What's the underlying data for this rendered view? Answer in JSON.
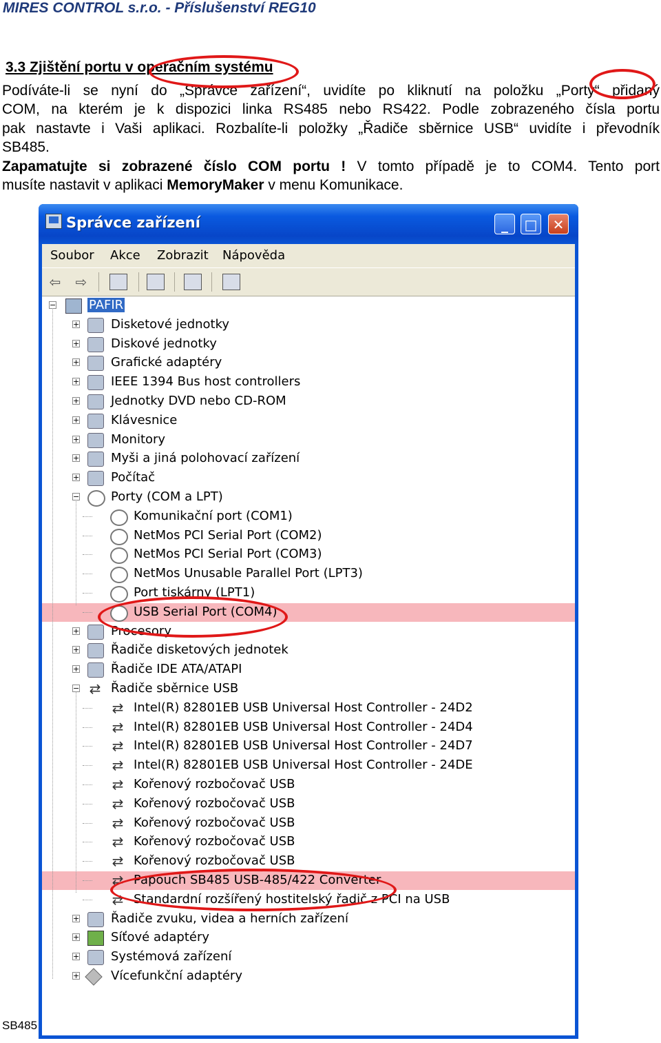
{
  "header": "MIRES CONTROL s.r.o. - Příslušenství REG10",
  "section_title": "3.3 Zjištění portu v operačním systému",
  "para1_lines": [
    "Podíváte-li se nyní do „Správce zařízení“, uvidíte po kliknutí na položku „Porty“ přidaný",
    "COM, na kterém je k dispozici linka RS485 nebo RS422. Podle zobrazeného čísla portu",
    "pak nastavte i Vaši aplikaci. Rozbalíte-li položky „Řadiče sběrnice USB“ uvidíte i převodník",
    "SB485."
  ],
  "para2": {
    "bold1": "Zapamatujte si zobrazené číslo COM portu !",
    "text1": " V tomto případě je to COM4. Tento port",
    "text2": "musíte nastavit v aplikaci ",
    "bold2": "MemoryMaker",
    "text3": " v menu Komunikace."
  },
  "footer": "SB485",
  "window": {
    "title": "Správce zařízení",
    "menu": [
      "Soubor",
      "Akce",
      "Zobrazit",
      "Nápověda"
    ],
    "tree": [
      {
        "label": "PAFIR",
        "level": 0,
        "expander": "minus",
        "icon": "comp",
        "selected": true
      },
      {
        "label": "Disketové jednotky",
        "level": 1,
        "expander": "plus",
        "icon": "dev"
      },
      {
        "label": "Diskové jednotky",
        "level": 1,
        "expander": "plus",
        "icon": "dev"
      },
      {
        "label": "Grafické adaptéry",
        "level": 1,
        "expander": "plus",
        "icon": "dev"
      },
      {
        "label": "IEEE 1394 Bus host controllers",
        "level": 1,
        "expander": "plus",
        "icon": "dev"
      },
      {
        "label": "Jednotky DVD nebo CD-ROM",
        "level": 1,
        "expander": "plus",
        "icon": "dev"
      },
      {
        "label": "Klávesnice",
        "level": 1,
        "expander": "plus",
        "icon": "dev"
      },
      {
        "label": "Monitory",
        "level": 1,
        "expander": "plus",
        "icon": "dev"
      },
      {
        "label": "Myši a jiná polohovací zařízení",
        "level": 1,
        "expander": "plus",
        "icon": "dev"
      },
      {
        "label": "Počítač",
        "level": 1,
        "expander": "plus",
        "icon": "dev"
      },
      {
        "label": "Porty (COM a LPT)",
        "level": 1,
        "expander": "minus",
        "icon": "port"
      },
      {
        "label": "Komunikační port (COM1)",
        "level": 2,
        "icon": "port"
      },
      {
        "label": "NetMos PCI Serial Port (COM2)",
        "level": 2,
        "icon": "port"
      },
      {
        "label": "NetMos PCI Serial Port (COM3)",
        "level": 2,
        "icon": "port"
      },
      {
        "label": "NetMos Unusable Parallel Port (LPT3)",
        "level": 2,
        "icon": "port"
      },
      {
        "label": "Port tiskárny (LPT1)",
        "level": 2,
        "icon": "port"
      },
      {
        "label": "USB Serial Port (COM4)",
        "level": 2,
        "icon": "port",
        "highlight": true
      },
      {
        "label": "Procesory",
        "level": 1,
        "expander": "plus",
        "icon": "dev"
      },
      {
        "label": "Řadiče disketových jednotek",
        "level": 1,
        "expander": "plus",
        "icon": "dev"
      },
      {
        "label": "Řadiče IDE ATA/ATAPI",
        "level": 1,
        "expander": "plus",
        "icon": "dev"
      },
      {
        "label": "Řadiče sběrnice USB",
        "level": 1,
        "expander": "minus",
        "icon": "usb"
      },
      {
        "label": "Intel(R) 82801EB USB Universal Host Controller - 24D2",
        "level": 2,
        "icon": "usb"
      },
      {
        "label": "Intel(R) 82801EB USB Universal Host Controller - 24D4",
        "level": 2,
        "icon": "usb"
      },
      {
        "label": "Intel(R) 82801EB USB Universal Host Controller - 24D7",
        "level": 2,
        "icon": "usb"
      },
      {
        "label": "Intel(R) 82801EB USB Universal Host Controller - 24DE",
        "level": 2,
        "icon": "usb"
      },
      {
        "label": "Kořenový rozbočovač USB",
        "level": 2,
        "icon": "usb"
      },
      {
        "label": "Kořenový rozbočovač USB",
        "level": 2,
        "icon": "usb"
      },
      {
        "label": "Kořenový rozbočovač USB",
        "level": 2,
        "icon": "usb"
      },
      {
        "label": "Kořenový rozbočovač USB",
        "level": 2,
        "icon": "usb"
      },
      {
        "label": "Kořenový rozbočovač USB",
        "level": 2,
        "icon": "usb"
      },
      {
        "label": "Papouch SB485 USB-485/422 Converter",
        "level": 2,
        "icon": "usb",
        "highlight": true
      },
      {
        "label": "Standardní rozšířený hostitelský řadič z PCI na USB",
        "level": 2,
        "icon": "usb"
      },
      {
        "label": "Řadiče zvuku, videa a herních zařízení",
        "level": 1,
        "expander": "plus",
        "icon": "dev"
      },
      {
        "label": "Síťové adaptéry",
        "level": 1,
        "expander": "plus",
        "icon": "grn"
      },
      {
        "label": "Systémová zařízení",
        "level": 1,
        "expander": "plus",
        "icon": "dev"
      },
      {
        "label": "Vícefunkční adaptéry",
        "level": 1,
        "expander": "plus",
        "icon": "dia"
      }
    ]
  },
  "colors": {
    "highlight": "#f7b7bc",
    "ellipse": "#e01818",
    "titlebar": "#0a54d4"
  }
}
